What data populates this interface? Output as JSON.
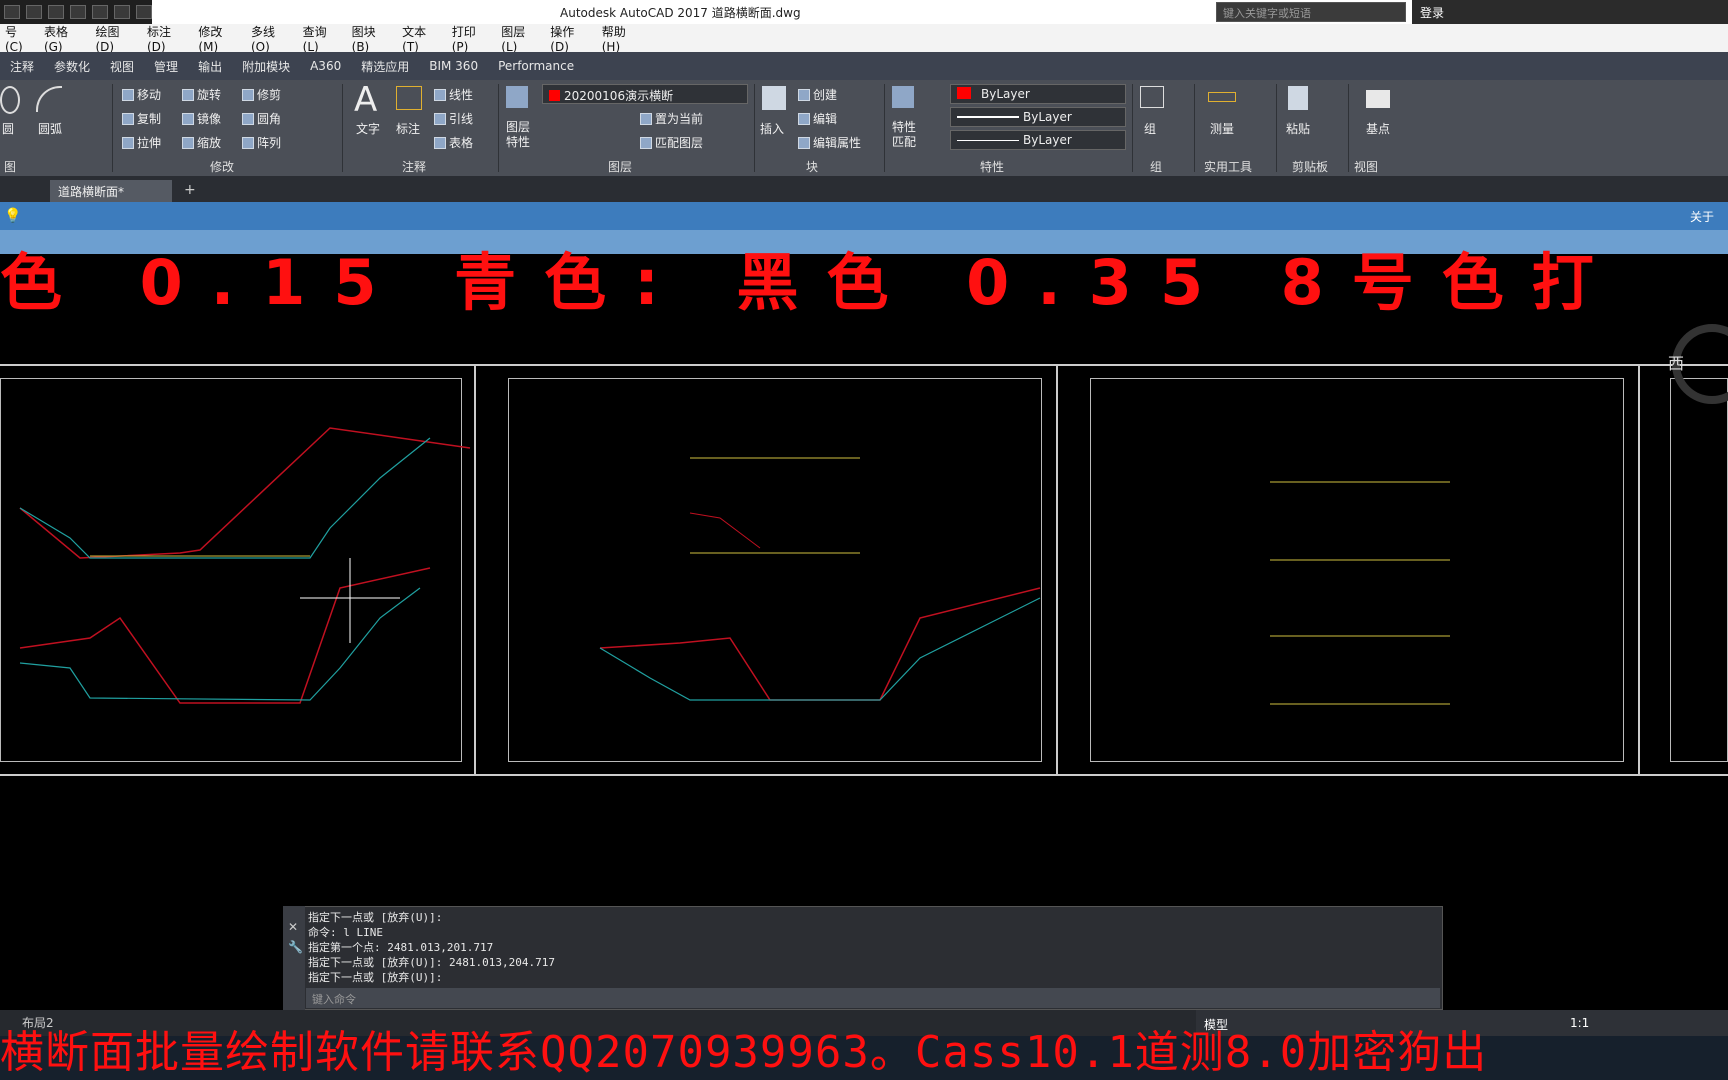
{
  "window": {
    "title": "Autodesk AutoCAD 2017    道路横断面.dwg",
    "search_placeholder": "键入关键字或短语",
    "login": "登录"
  },
  "menu": [
    "号(C)",
    "表格(G)",
    "绘图(D)",
    "标注(D)",
    "修改(M)",
    "多线(O)",
    "查询(L)",
    "图块(B)",
    "文本(T)",
    "打印(P)",
    "图层(L)",
    "操作(D)",
    "帮助(H)"
  ],
  "ribbon_tabs": [
    "注释",
    "参数化",
    "视图",
    "管理",
    "输出",
    "附加模块",
    "A360",
    "精选应用",
    "BIM 360",
    "Performance"
  ],
  "ribbon": {
    "draw": {
      "circle": "圆",
      "arc": "圆弧",
      "panel": "图"
    },
    "modify": {
      "move": "移动",
      "rotate": "旋转",
      "trim": "修剪",
      "copy": "复制",
      "mirror": "镜像",
      "fillet": "圆角",
      "stretch": "拉伸",
      "scale": "缩放",
      "array": "阵列",
      "panel": "修改"
    },
    "annotation": {
      "text": "文字",
      "dim": "标注",
      "linear": "线性",
      "leader": "引线",
      "table": "表格",
      "panel": "注释"
    },
    "layers": {
      "props": "图层\n特性",
      "current_layer": "20200106演示横断",
      "set_current": "置为当前",
      "match": "匹配图层",
      "panel": "图层"
    },
    "block": {
      "insert": "插入",
      "create": "创建",
      "edit": "编辑",
      "edit_attr": "编辑属性",
      "panel": "块"
    },
    "properties": {
      "match": "特性\n匹配",
      "color": "ByLayer",
      "linetype": "ByLayer",
      "lineweight": "ByLayer",
      "panel": "特性"
    },
    "groups": {
      "group": "组",
      "panel": "组"
    },
    "utilities": {
      "measure": "测量",
      "panel": "实用工具"
    },
    "clipboard": {
      "paste": "粘贴",
      "panel": "剪贴板"
    },
    "view": {
      "base": "基点",
      "panel": "视图"
    }
  },
  "doc_tab": "道路横断面*",
  "info_about": "关于",
  "canvas_text": "色  0.15  青色: 黑色  0.35  8号色打",
  "nav_label": "西",
  "command": {
    "lines": [
      "指定下一点或 [放弃(U)]:",
      "命令: l LINE",
      "指定第一个点: 2481.013,201.717",
      "指定下一点或 [放弃(U)]: 2481.013,204.717",
      "指定下一点或 [放弃(U)]:"
    ],
    "input_placeholder": "键入命令"
  },
  "layout_tab": "布局2",
  "status": {
    "model": "模型",
    "scale": "1:1"
  },
  "banner": "横断面批量绘制软件请联系QQ2070939963。Cass10.1道测8.0加密狗出"
}
